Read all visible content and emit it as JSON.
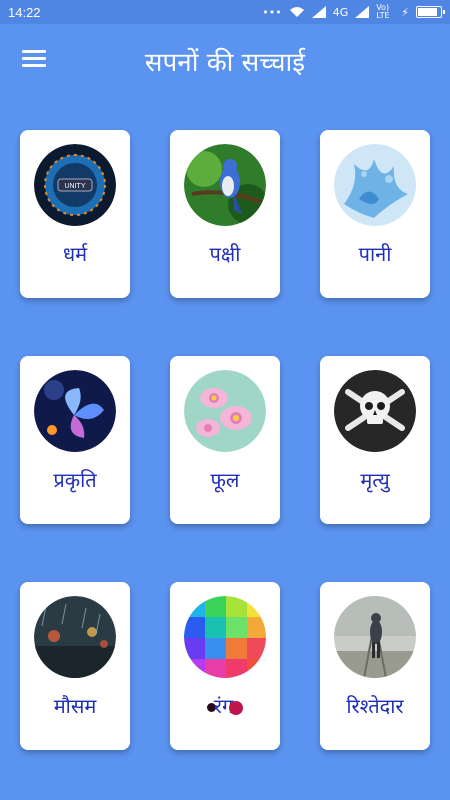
{
  "status_bar": {
    "time": "14:22",
    "network": "4G",
    "volte": "Vo) LTE"
  },
  "app": {
    "title": "सपनों की सच्चाई"
  },
  "categories": [
    {
      "label": "धर्म",
      "image": "unity-globe"
    },
    {
      "label": "पक्षी",
      "image": "blue-jay-bird"
    },
    {
      "label": "पानी",
      "image": "water-splash"
    },
    {
      "label": "प्रकृति",
      "image": "glowing-butterfly"
    },
    {
      "label": "फूल",
      "image": "pink-flowers"
    },
    {
      "label": "मृत्यु",
      "image": "skull-crossbones"
    },
    {
      "label": "मौसम",
      "image": "rainy-street"
    },
    {
      "label": "रंग",
      "image": "colorful-cubes"
    },
    {
      "label": "रिश्तेदार",
      "image": "man-walking-on-tracks"
    }
  ],
  "colors": {
    "background": "#5b93f0",
    "label": "#1f2fb8",
    "card": "#ffffff"
  }
}
